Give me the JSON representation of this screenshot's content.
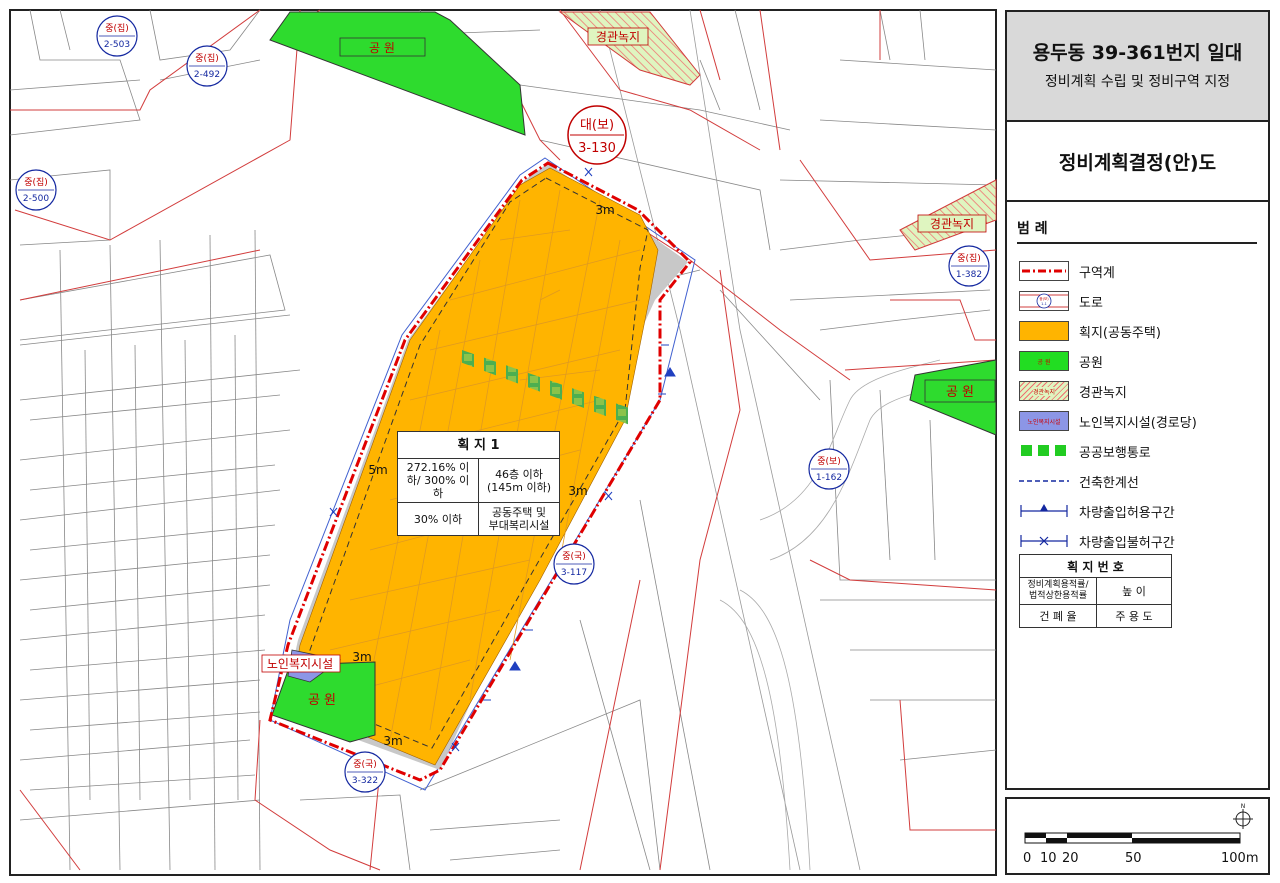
{
  "header": {
    "title": "용두동 39-361번지 일대",
    "subtitle": "정비계획 수립 및 정비구역 지정",
    "plan_title": "정비계획결정(안)도"
  },
  "legend": {
    "heading": "범 례",
    "items": [
      {
        "label": "구역계",
        "icon": "district-boundary-line"
      },
      {
        "label": "도로",
        "icon": "road-symbol"
      },
      {
        "label": "획지(공동주택)",
        "icon": "lot-fill",
        "color": "#FFB400"
      },
      {
        "label": "공원",
        "icon": "park-fill",
        "color": "#22DD22"
      },
      {
        "label": "경관녹지",
        "icon": "landscape-green-hatch",
        "color": "#C8F0A0"
      },
      {
        "label": "노인복지시설(경로당)",
        "icon": "senior-facility-fill",
        "color": "#8C96E6"
      },
      {
        "label": "공공보행통로",
        "icon": "public-walkway-squares",
        "color": "#22CC22"
      },
      {
        "label": "건축한계선",
        "icon": "building-line-dashed"
      },
      {
        "label": "차량출입허용구간",
        "icon": "vehicle-entry-allowed"
      },
      {
        "label": "차량출입불허구간",
        "icon": "vehicle-entry-prohibited"
      }
    ],
    "symbol_texts": {
      "park": "공 원",
      "landscape": "경관녹지",
      "senior": "노인복지시설",
      "road_top": "중(보)",
      "road_bottom": "1-1"
    },
    "lot_key": {
      "title": "획 지 번 호",
      "far": "정비계획용적률/ 법적상한용적률",
      "height": "높 이",
      "bcr": "건 폐 율",
      "use": "주 용 도"
    }
  },
  "lot_info": {
    "title": "획 지 1",
    "far": "272.16% 이하/ 300% 이하",
    "height_1": "46층 이하",
    "height_2": "(145m 이하)",
    "bcr": "30% 이하",
    "use_1": "공동주택 및",
    "use_2": "부대복리시설"
  },
  "map_labels": {
    "park_top": "공 원",
    "park_bottom": "공 원",
    "park_right": "공 원",
    "landscape_top": "경관녹지",
    "landscape_right": "경관녹지",
    "senior_facility": "노인복지시설",
    "setback_labels": [
      "3m",
      "5m",
      "3m",
      "3m",
      "3m"
    ],
    "roads": [
      {
        "top": "중(집)",
        "bottom": "2-503"
      },
      {
        "top": "중(집)",
        "bottom": "2-492"
      },
      {
        "top": "중(집)",
        "bottom": "2-500"
      },
      {
        "top": "대(보)",
        "bottom": "3-130"
      },
      {
        "top": "중(집)",
        "bottom": "1-382"
      },
      {
        "top": "중(보)",
        "bottom": "1-162"
      },
      {
        "top": "중(국)",
        "bottom": "3-117"
      },
      {
        "top": "중(국)",
        "bottom": "3-322"
      }
    ]
  },
  "scale": {
    "ticks": [
      "0",
      "10",
      "20",
      "50",
      "100m"
    ],
    "north": "N"
  },
  "colors": {
    "boundary": "#E00000",
    "lot": "#FFB400",
    "park": "#22DD22",
    "road_lines": "#D23C3C",
    "road_circle": "#1428A0",
    "walkway": "#3CA03C"
  }
}
